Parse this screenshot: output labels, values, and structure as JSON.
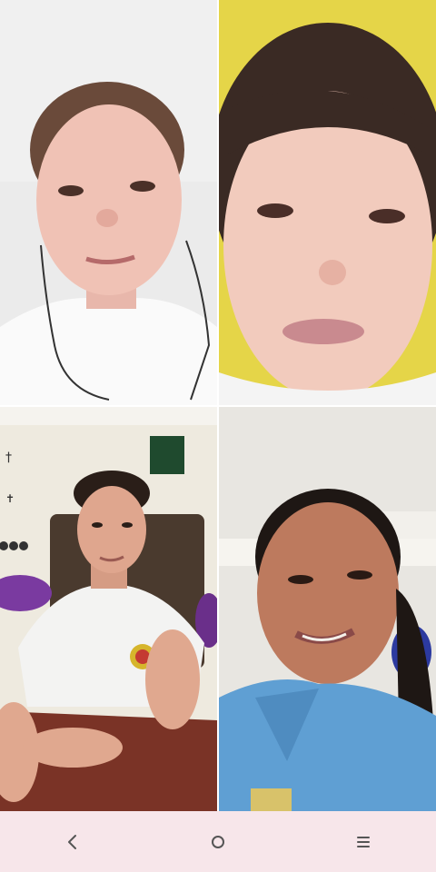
{
  "video_call": {
    "participants": [
      {
        "tile": "top-left",
        "background": "#ececec"
      },
      {
        "tile": "top-right",
        "background": "#e7d84a"
      },
      {
        "tile": "bottom-left",
        "background": "#efece0"
      },
      {
        "tile": "bottom-right",
        "background": "#e8e6e1"
      }
    ]
  },
  "system_nav": {
    "background": "#f7e6ea",
    "icon_color": "#555555",
    "buttons": [
      {
        "icon": "back-icon"
      },
      {
        "icon": "home-icon"
      },
      {
        "icon": "recents-icon"
      }
    ]
  }
}
